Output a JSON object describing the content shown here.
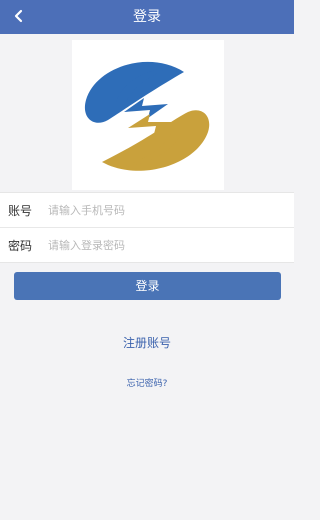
{
  "header": {
    "title": "登录",
    "back_icon": "chevron-left-icon"
  },
  "logo": {
    "icon": "company-logo",
    "colors": {
      "blue": "#2e6db8",
      "gold": "#c9a13c"
    }
  },
  "form": {
    "account": {
      "label": "账号",
      "placeholder": "请输入手机号码"
    },
    "password": {
      "label": "密码",
      "placeholder": "请输入登录密码"
    }
  },
  "actions": {
    "login_label": "登录",
    "register_label": "注册账号",
    "forgot_label": "忘记密码?"
  },
  "theme": {
    "header_color": "#4c6fb8",
    "button_color": "#4a74b6",
    "link_color": "#3b62ad",
    "page_background": "#f3f3f5"
  }
}
